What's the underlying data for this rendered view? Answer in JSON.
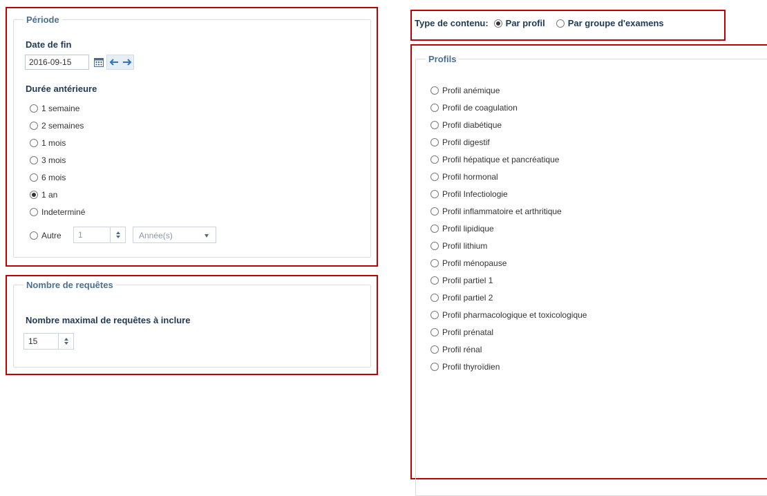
{
  "colors": {
    "highlight": "#c00000",
    "legend": "#4a6f93",
    "label": "#1f3a56",
    "border": "#d9dde3"
  },
  "periode": {
    "legend": "Période",
    "end_date_label": "Date de fin",
    "end_date_value": "2016-09-15",
    "icons": [
      "calendar-icon",
      "arrow-left-icon",
      "arrow-right-icon"
    ],
    "duration_label": "Durée antérieure",
    "options": [
      {
        "label": "1 semaine",
        "checked": false
      },
      {
        "label": "2 semaines",
        "checked": false
      },
      {
        "label": "1 mois",
        "checked": false
      },
      {
        "label": "3 mois",
        "checked": false
      },
      {
        "label": "6 mois",
        "checked": false
      },
      {
        "label": "1 an",
        "checked": true
      },
      {
        "label": "Indeterminé",
        "checked": false
      }
    ],
    "other": {
      "label": "Autre",
      "value": "1",
      "unit": "Année(s)"
    }
  },
  "requetes": {
    "legend": "Nombre de requêtes",
    "max_label": "Nombre maximal de requêtes à inclure",
    "max_value": "15"
  },
  "content_type": {
    "label": "Type de contenu:",
    "options": [
      {
        "label": "Par profil",
        "checked": true
      },
      {
        "label": "Par groupe d'examens",
        "checked": false
      }
    ]
  },
  "profils": {
    "legend": "Profils",
    "items": [
      "Profil anémique",
      "Profil de coagulation",
      "Profil diabétique",
      "Profil digestif",
      "Profil hépatique et pancréatique",
      "Profil hormonal",
      "Profil Infectiologie",
      "Profil inflammatoire et arthritique",
      "Profil lipidique",
      "Profil lithium",
      "Profil ménopause",
      "Profil partiel 1",
      "Profil partiel 2",
      "Profil pharmacologique et toxicologique",
      "Profil prénatal",
      "Profil rénal",
      "Profil thyroïdien"
    ]
  }
}
